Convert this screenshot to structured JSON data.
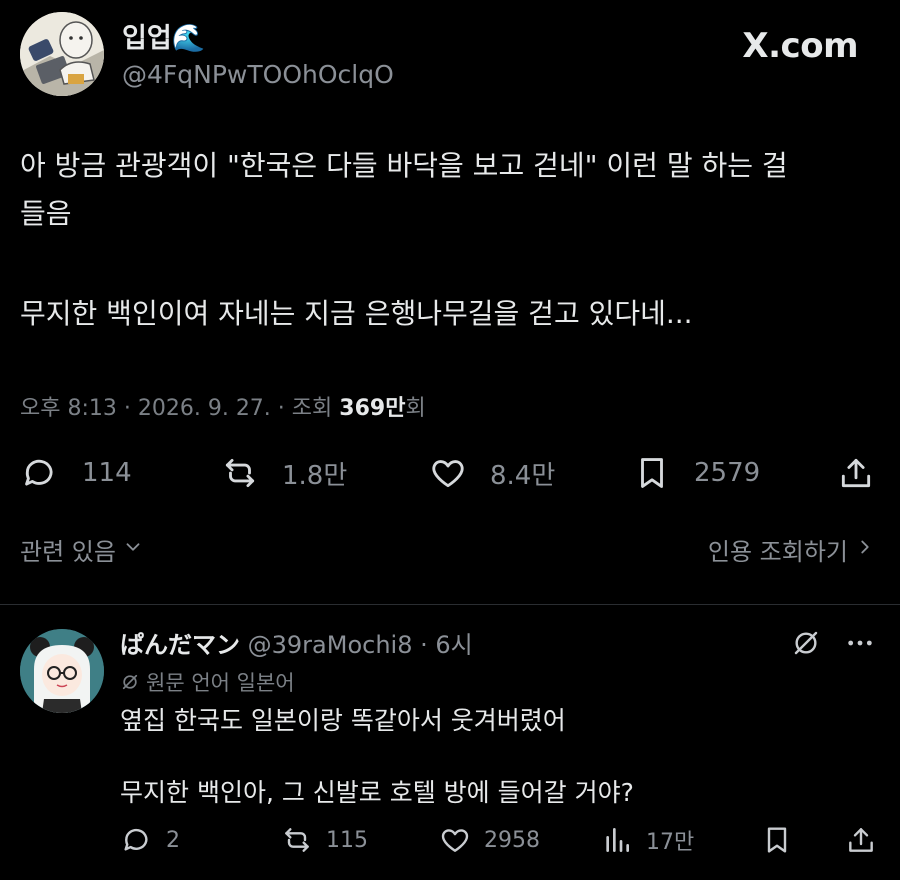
{
  "brand": "X.com",
  "post": {
    "display_name": "입업🌊",
    "handle": "@4FqNPwTOOhOclqO",
    "lines": [
      "아 방금 관광객이 \"한국은 다들 바닥을 보고 걷네\" 이런 말 하는 걸",
      "들음",
      "무지한 백인이여 자네는 지금 은행나무길을 걷고 있다네..."
    ],
    "meta": {
      "time_date": "오후 8:13 · 2026. 9. 27. · 조회 ",
      "views": "369만",
      "views_suffix": "회"
    },
    "actions": {
      "replies": "114",
      "reposts": "1.8만",
      "likes": "8.4만",
      "bookmarks": "2579"
    },
    "icons": [
      "reply-icon",
      "repost-icon",
      "like-icon",
      "bookmark-icon",
      "share-icon"
    ]
  },
  "related": {
    "left_label": "관련 있음",
    "right_label": "인용 조회하기"
  },
  "reply": {
    "display_name": "ぱんだマン",
    "handle": "@39raMochi8",
    "time": " · 6시",
    "translation_note": "원문 언어 일본어",
    "lines": [
      "옆집 한국도 일본이랑 똑같아서 웃겨버렸어",
      "무지한 백인아, 그 신발로 호텔 방에 들어갈 거야?"
    ],
    "actions": {
      "replies": "2",
      "reposts": "115",
      "likes": "2958",
      "views": "17만"
    }
  },
  "colors": {
    "background": "#000000",
    "text_primary": "#e7e9ea",
    "text_secondary": "#8b9097",
    "divider": "#2a2d31"
  }
}
